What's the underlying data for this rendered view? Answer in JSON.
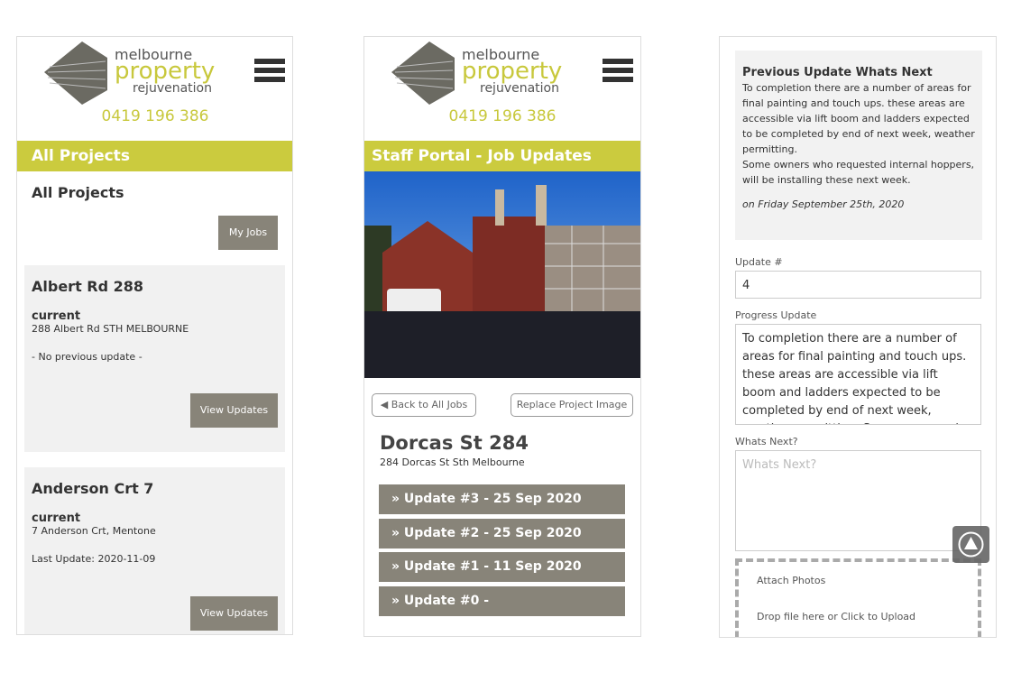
{
  "brand": {
    "line1": "melbourne",
    "line2": "property",
    "line3": "rejuvenation",
    "phone": "0419 196 386",
    "menu_icon": "hamburger-icon",
    "accent": "#cbcb3e",
    "button_grey": "#888479"
  },
  "left": {
    "bar_title": "All Projects",
    "heading": "All Projects",
    "my_jobs": "My Jobs",
    "projects": [
      {
        "name": "Albert Rd 288",
        "status": "current",
        "address": "288 Albert Rd STH MELBOURNE",
        "last": "- No previous update -",
        "button": "View Updates"
      },
      {
        "name": "Anderson Crt 7",
        "status": "current",
        "address": "7 Anderson Crt, Mentone",
        "last": "Last Update: 2020-11-09",
        "button": "View Updates"
      }
    ]
  },
  "middle": {
    "bar_title": "Staff Portal - Job Updates",
    "back": "Back to All Jobs",
    "replace": "Replace Project Image",
    "title": "Dorcas St 284",
    "address": "284 Dorcas St Sth Melbourne",
    "updates": [
      "Update #3 - 25 Sep 2020",
      "Update #2 - 25 Sep 2020",
      "Update #1 - 11 Sep 2020",
      "Update #0 -"
    ]
  },
  "right": {
    "prev_title": "Previous Update Whats Next",
    "prev_text1": "To completion there are a number of areas for final painting and touch ups. these areas are accessible via lift boom and ladders expected to be completed by end of next week, weather permitting.",
    "prev_text2": "Some owners who requested internal hoppers, will be installing these next week.",
    "prev_date": "on Friday September 25th, 2020",
    "update_label": "Update #",
    "update_value": "4",
    "progress_label": "Progress Update",
    "progress_value": "To completion there are a number of areas for final painting and touch ups. these areas are accessible via lift boom and ladders expected to be completed by end of next week, weather permitting. Some owners who requested internal hoppers",
    "next_label": "Whats Next?",
    "next_placeholder": "Whats Next?",
    "attach": "Attach Photos",
    "drop": "Drop file here or Click to Upload"
  }
}
